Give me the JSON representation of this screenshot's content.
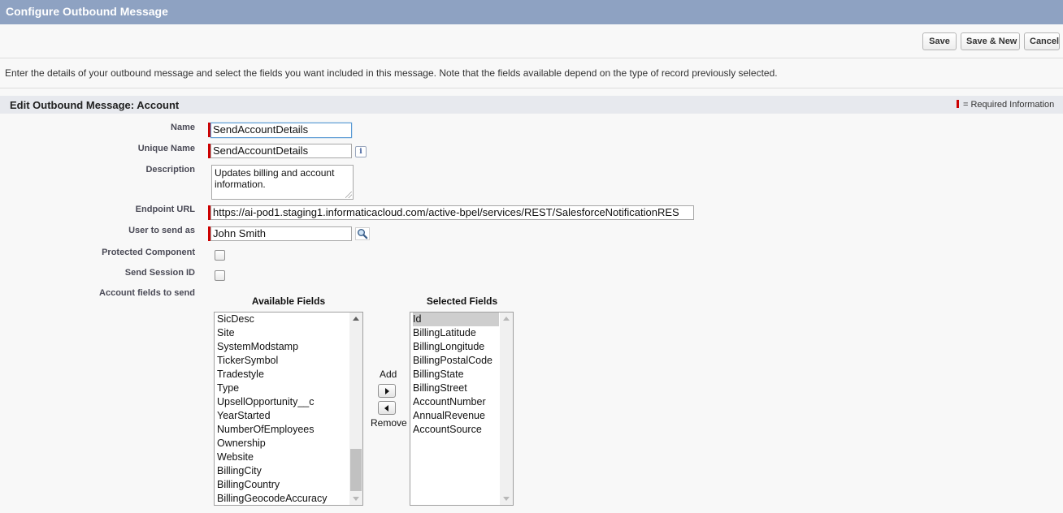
{
  "header": {
    "title": "Configure Outbound Message"
  },
  "toolbar": {
    "save_label": "Save",
    "save_new_label": "Save & New",
    "cancel_label": "Cancel"
  },
  "intro": "Enter the details of your outbound message and select the fields you want included in this message. Note that the fields available depend on the type of record previously selected.",
  "section": {
    "title": "Edit Outbound Message: Account",
    "required_legend": "= Required Information"
  },
  "form": {
    "name": {
      "label": "Name",
      "value": "SendAccountDetails"
    },
    "unique_name": {
      "label": "Unique Name",
      "value": "SendAccountDetails"
    },
    "description": {
      "label": "Description",
      "value": "Updates billing and account information."
    },
    "endpoint_url": {
      "label": "Endpoint URL",
      "value": "https://ai-pod1.staging1.informaticacloud.com/active-bpel/services/REST/SalesforceNotificationRES"
    },
    "user_to_send_as": {
      "label": "User to send as",
      "value": "John Smith"
    },
    "protected_component": {
      "label": "Protected Component",
      "checked": false
    },
    "send_session_id": {
      "label": "Send Session ID",
      "checked": false
    },
    "fields_to_send": {
      "label": "Account fields to send"
    }
  },
  "available_fields": {
    "title": "Available Fields",
    "items": [
      "SicDesc",
      "Site",
      "SystemModstamp",
      "TickerSymbol",
      "Tradestyle",
      "Type",
      "UpsellOpportunity__c",
      "YearStarted",
      "NumberOfEmployees",
      "Ownership",
      "Website",
      "BillingCity",
      "BillingCountry",
      "BillingGeocodeAccuracy"
    ]
  },
  "selected_fields": {
    "title": "Selected Fields",
    "items": [
      "Id",
      "BillingLatitude",
      "BillingLongitude",
      "BillingPostalCode",
      "BillingState",
      "BillingStreet",
      "AccountNumber",
      "AnnualRevenue",
      "AccountSource"
    ],
    "highlighted": "Id"
  },
  "mover": {
    "add_label": "Add",
    "remove_label": "Remove"
  },
  "colors": {
    "header_bar": "#8ea2c2",
    "required": "#cc0000",
    "section_bar": "#e7e9ee"
  }
}
